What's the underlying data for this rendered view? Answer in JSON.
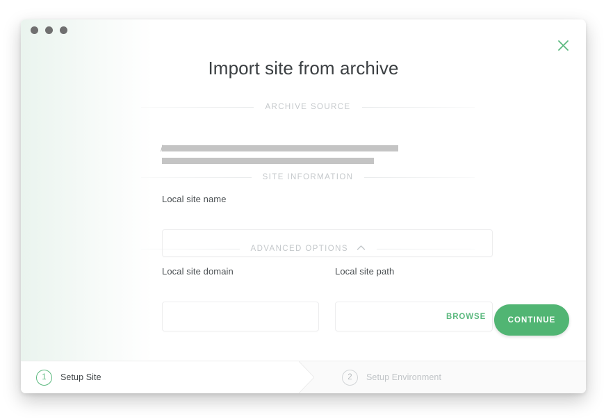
{
  "window": {
    "traffic_lights": [
      "close",
      "minimize",
      "maximize"
    ]
  },
  "dialog": {
    "title": "Import site from archive",
    "close_icon": "close-icon"
  },
  "sections": {
    "archive_source": {
      "label": "ARCHIVE SOURCE",
      "redacted_value_slash": "/",
      "redacted": true
    },
    "site_information": {
      "label": "SITE INFORMATION"
    },
    "advanced_options": {
      "label": "ADVANCED OPTIONS",
      "chevron_icon": "chevron-up-icon",
      "expanded": true
    }
  },
  "fields": {
    "site_name": {
      "label": "Local site name",
      "value": "",
      "placeholder": ""
    },
    "site_domain": {
      "label": "Local site domain",
      "value": "",
      "placeholder": ""
    },
    "site_path": {
      "label": "Local site path",
      "value": "",
      "placeholder": "",
      "browse_label": "BROWSE"
    }
  },
  "actions": {
    "continue_label": "CONTINUE"
  },
  "steps": [
    {
      "number": "1",
      "label": "Setup Site",
      "active": true
    },
    {
      "number": "2",
      "label": "Setup Environment",
      "active": false
    }
  ],
  "colors": {
    "accent_green": "#51b573",
    "accent_green_text": "#5cb97f",
    "title_text": "#3b3f42",
    "divider_text": "#c4c8cb",
    "redaction": "#c4c4c4"
  }
}
